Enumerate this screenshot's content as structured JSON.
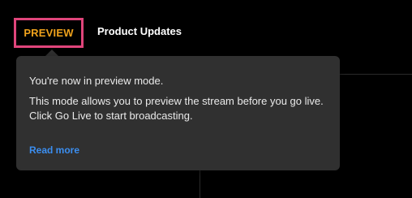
{
  "header": {
    "badge_label": "PREVIEW",
    "stream_title": "Product Updates"
  },
  "tooltip": {
    "line1": "You're now in preview mode.",
    "line2": "This mode allows you to preview the stream before you go live. Click Go Live to start broadcasting.",
    "read_more": "Read more"
  },
  "colors": {
    "background": "#000000",
    "badge_border": "#e0457b",
    "badge_text": "#f0a21c",
    "tooltip_bg": "#303030",
    "link": "#3b8ef0"
  }
}
